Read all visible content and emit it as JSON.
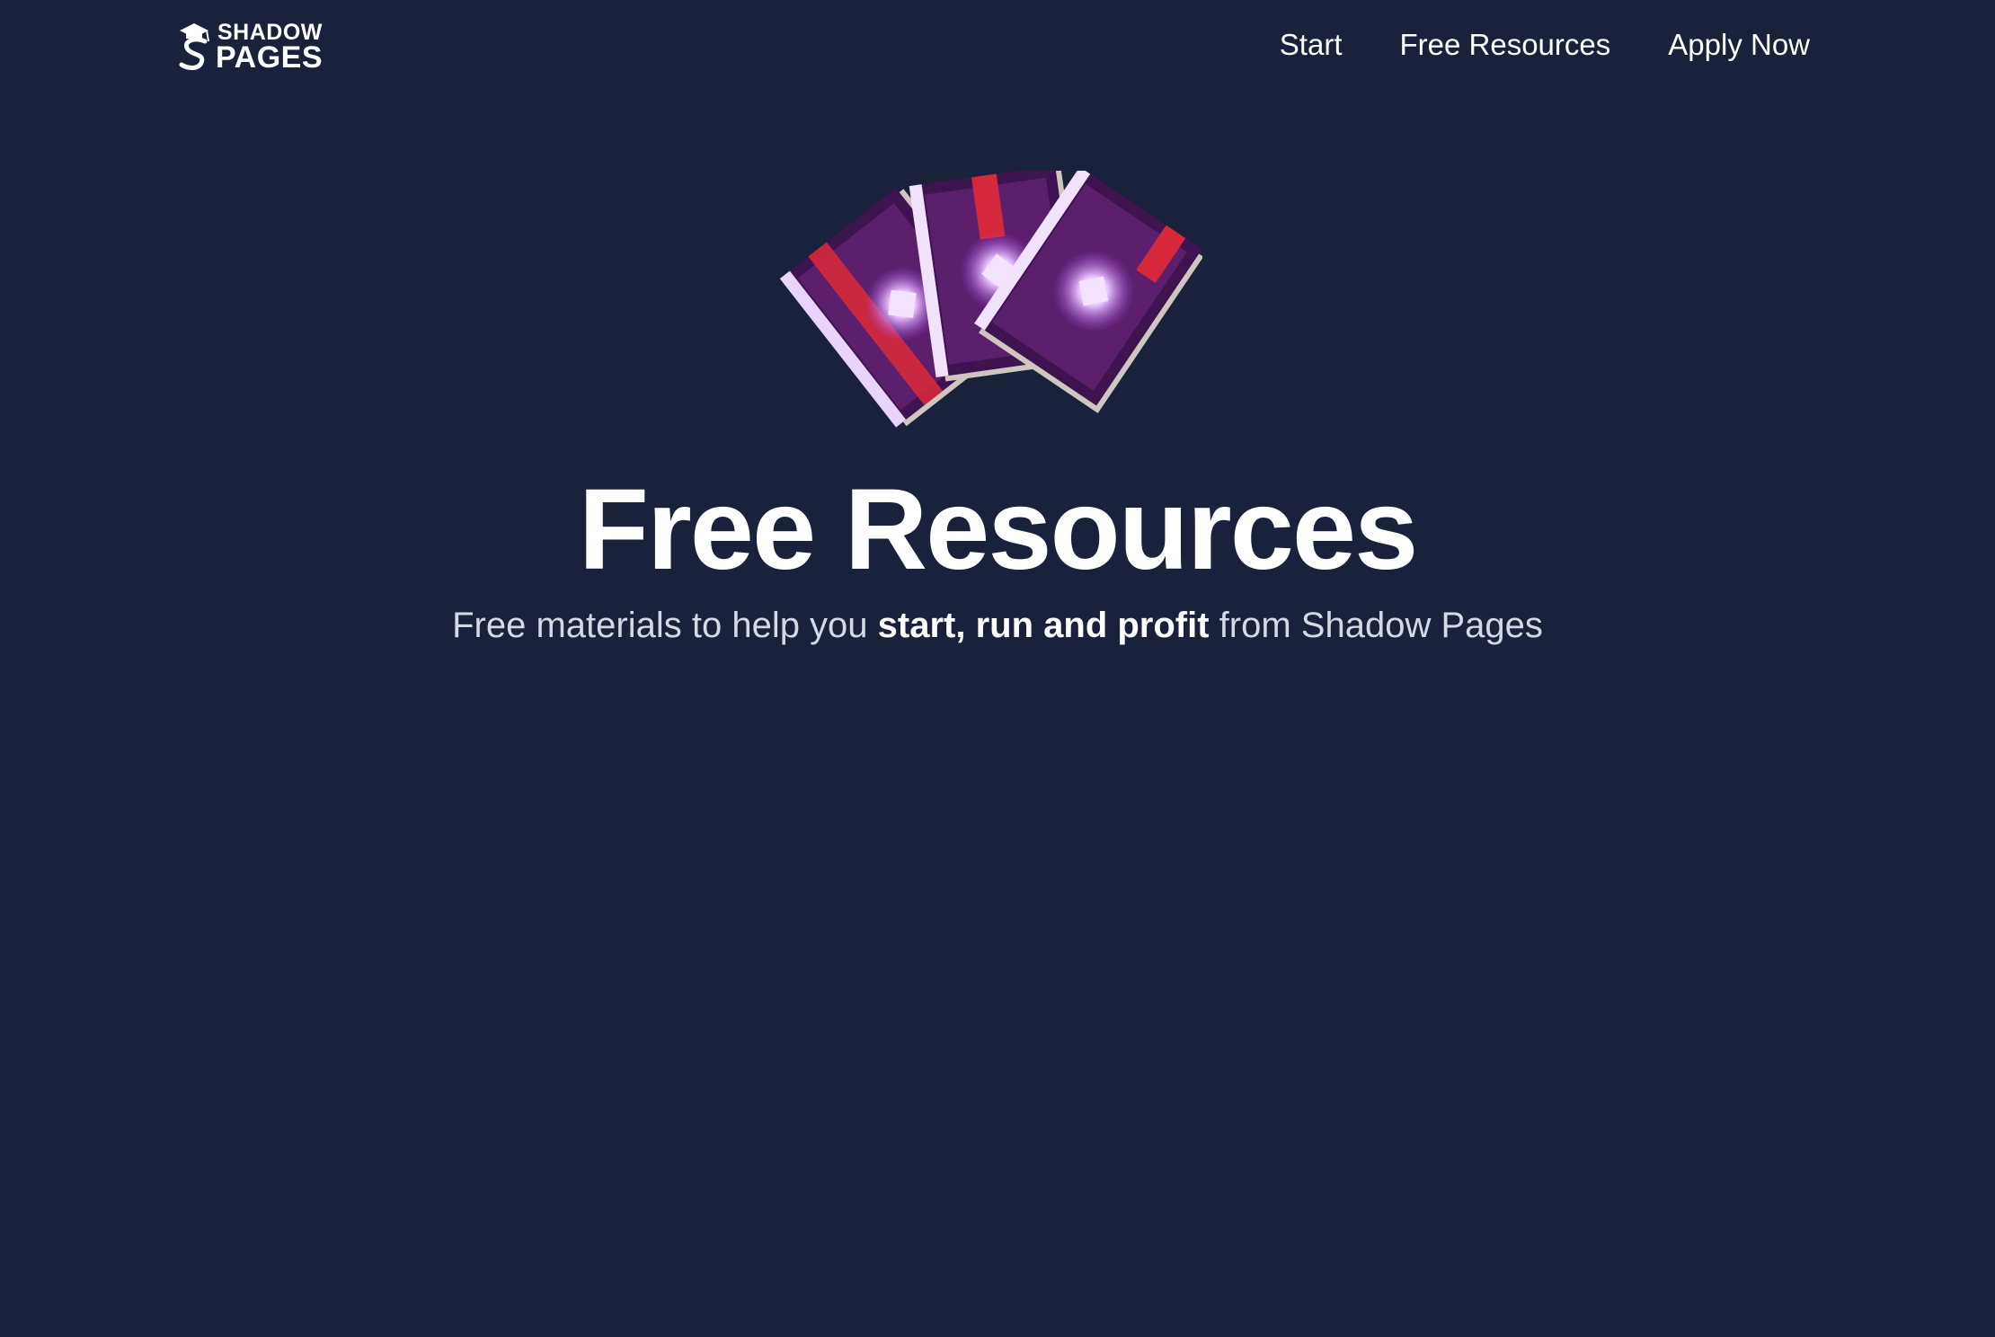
{
  "nav": {
    "logo": {
      "line1": "SHADOW",
      "line2": "PAGES"
    },
    "links": [
      {
        "label": "Start"
      },
      {
        "label": "Free Resources"
      },
      {
        "label": "Apply Now"
      }
    ]
  },
  "hero": {
    "image_icon": "enchanted-books-icon",
    "title": "Free Resources",
    "subtitle": {
      "before": "Free materials to help you ",
      "emphasis": "start, run and profit",
      "after": " from Shadow Pages"
    }
  },
  "colors": {
    "background": "#19223a",
    "text": "#ffffff",
    "subtitle_text": "#d5d9e3",
    "book_cover": "#5b1f6e",
    "book_glow": "#d9a2ff",
    "book_strap": "#d6283b",
    "book_pages": "#cfc6c0"
  }
}
